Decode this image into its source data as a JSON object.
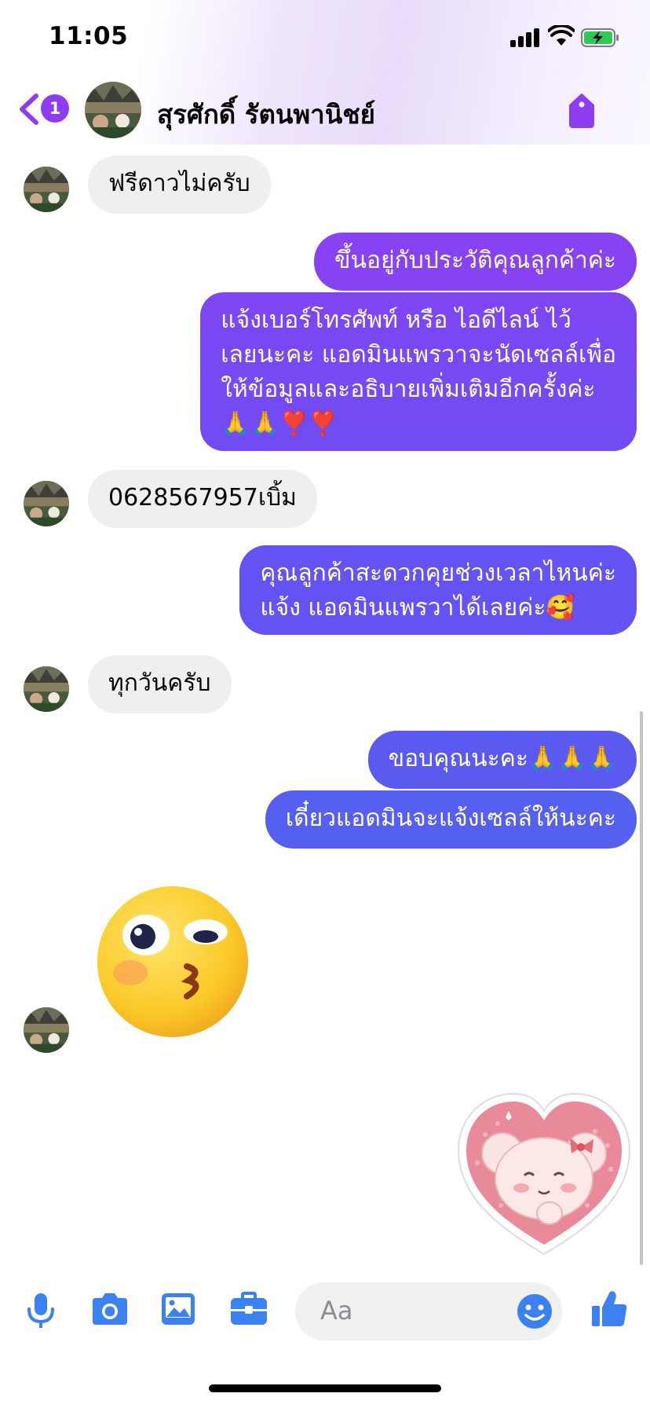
{
  "status_bar": {
    "time": "11:05"
  },
  "header": {
    "back_badge_count": "1",
    "contact_name": "สุรศักดิ์ รัตนพานิชย์"
  },
  "messages": [
    {
      "side": "in",
      "text": "ฟรีดาวไม่ครับ"
    },
    {
      "side": "out",
      "text": "ขึ้นอยู่กับประวัติคุณลูกค้าค่ะ"
    },
    {
      "side": "out",
      "lines": [
        "แจ้งเบอร์โทรศัพท์ หรือ ไอดีไลน์  ไว้",
        "เลยนะคะ แอดมินแพรวาจะนัดเซลล์เพื่อ",
        "ให้ข้อมูลและอธิบายเพิ่มเติมอีกครั้งค่ะ",
        "🙏🙏❣️❣️"
      ]
    },
    {
      "side": "in",
      "text": "0628567957เบิ้ม"
    },
    {
      "side": "out",
      "lines": [
        "คุณลูกค้าสะดวกคุยช่วงเวลาไหนค่ะ",
        "แจ้ง แอดมินแพรวาได้เลยค่ะ🥰"
      ]
    },
    {
      "side": "in",
      "text": "ทุกวันครับ"
    },
    {
      "side": "out",
      "text": "ขอบคุณนะคะ🙏🙏🙏"
    },
    {
      "side": "out",
      "text": "เดี๋ยวแอดมินจะแจ้งเซลล์ให้นะคะ"
    }
  ],
  "stickers": {
    "incoming": "kissing-face-sticker",
    "outgoing": "bear-heart-sticker"
  },
  "composer": {
    "placeholder": "Aa"
  },
  "colors": {
    "accent": "#8e3cf0",
    "bubble_out_top": "#8a43f0",
    "bubble_out_bottom": "#5a5af0",
    "bubble_in": "#efefef",
    "composer_icons": "#3b82f0"
  }
}
